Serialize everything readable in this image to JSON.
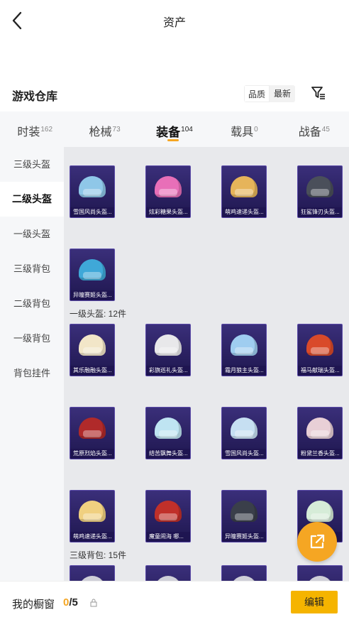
{
  "header": {
    "title": "资产",
    "back_icon": "chevron-left-icon"
  },
  "warehouse": {
    "title": "游戏仓库",
    "sort_options": [
      "品质",
      "最新"
    ],
    "active_sort": "最新",
    "filter_icon": "filter-icon"
  },
  "tabs": [
    {
      "label": "时装",
      "count": "162"
    },
    {
      "label": "枪械",
      "count": "73"
    },
    {
      "label": "装备",
      "count": "104",
      "active": true
    },
    {
      "label": "载具",
      "count": "0"
    },
    {
      "label": "战备",
      "count": "45"
    }
  ],
  "sidebar": {
    "items": [
      "三级头盔",
      "二级头盔",
      "一级头盔",
      "三级背包",
      "二级背包",
      "一级背包",
      "背包挂件"
    ],
    "active": "二级头盔"
  },
  "groups": {
    "level2_items": [
      {
        "name": "雪国风尚头盔...",
        "color": "#8fc7e8"
      },
      {
        "name": "炫彩糖果头盔...",
        "color": "#e86fb8"
      },
      {
        "name": "萌鸡速递头盔...",
        "color": "#e6b45a"
      },
      {
        "name": "狂鲨锋刃头盔...",
        "color": "#4a4f5a"
      },
      {
        "name": "异瞳赛姬头盔...",
        "color": "#3fa8d8"
      }
    ],
    "level1_label": "一级头盔: 12件",
    "level1_items": [
      {
        "name": "其乐融融头盔...",
        "color": "#f2e6c8"
      },
      {
        "name": "彩旗巡礼头盔...",
        "color": "#e8e8ea"
      },
      {
        "name": "霜月狼主头盔...",
        "color": "#9fcdf0"
      },
      {
        "name": "福马献瑞头盔...",
        "color": "#d94a2a"
      },
      {
        "name": "荒原烈焰头盔...",
        "color": "#b02a2a"
      },
      {
        "name": "结苦飘舞头盔...",
        "color": "#bfe4f2"
      },
      {
        "name": "雪国风尚头盔...",
        "color": "#c6dff2"
      },
      {
        "name": "粉黛兰香头盔...",
        "color": "#e8cfd6"
      },
      {
        "name": "萌鸡速递头盔...",
        "color": "#f0d080"
      },
      {
        "name": "魔童闹海 哪...",
        "color": "#c0302a"
      },
      {
        "name": "异瞳赛姬头盔...",
        "color": "#3a3f4a"
      },
      {
        "name": "",
        "color": "#d6ecd8"
      }
    ],
    "level3_backpack_label": "三级背包: 15件",
    "level3_backpack_items": [
      {
        "name": "",
        "color": "#cfcfd8"
      },
      {
        "name": "",
        "color": "#cfcfd8"
      },
      {
        "name": "",
        "color": "#cfcfd8"
      },
      {
        "name": "",
        "color": "#cfcfd8"
      }
    ]
  },
  "floating": {
    "icon": "external-link-icon"
  },
  "bottom": {
    "label": "我的橱窗",
    "current": "0",
    "total": "/5",
    "lock_icon": "lock-icon",
    "edit_label": "编辑"
  },
  "colors": {
    "accent": "#f5a623",
    "card_bg": "#2a2060"
  }
}
